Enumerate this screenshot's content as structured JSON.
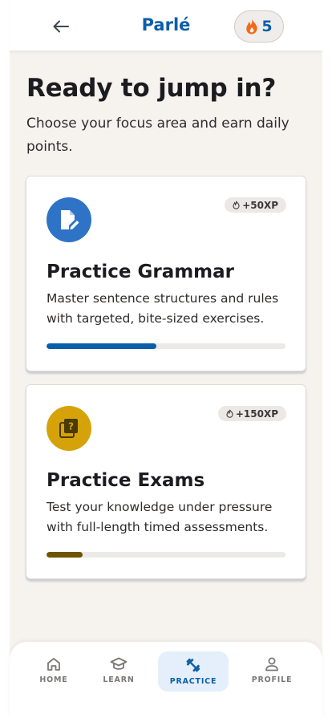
{
  "header": {
    "brand": "Parlé",
    "streak_count": "5",
    "back_icon": "arrow-left-icon",
    "streak_icon": "flame-icon"
  },
  "main": {
    "title": "Ready to jump in?",
    "subtitle": "Choose your focus area and earn daily points."
  },
  "cards": [
    {
      "title": "Practice Grammar",
      "description": "Master sentence structures and rules with targeted, bite-sized exercises.",
      "xp": "+50XP",
      "icon": "edit-document-icon",
      "progress": 0.46,
      "icon_color": "#2f73c6",
      "progress_color": "#0b5ea8"
    },
    {
      "title": "Practice Exams",
      "description": "Test your knowledge under pressure with full-length timed assessments.",
      "xp": "+150XP",
      "icon": "quiz-icon",
      "progress": 0.15,
      "icon_color": "#d5a309",
      "progress_color": "#6e5400"
    }
  ],
  "nav": {
    "items": [
      {
        "label": "HOME",
        "icon": "home-icon",
        "active": false
      },
      {
        "label": "LEARN",
        "icon": "graduation-cap-icon",
        "active": false
      },
      {
        "label": "PRACTICE",
        "icon": "fitness-icon",
        "active": true
      },
      {
        "label": "PROFILE",
        "icon": "person-icon",
        "active": false
      }
    ]
  },
  "colors": {
    "brand": "#0b5ea8",
    "background": "#f6f3ef",
    "active_nav_bg": "#e4effb"
  }
}
